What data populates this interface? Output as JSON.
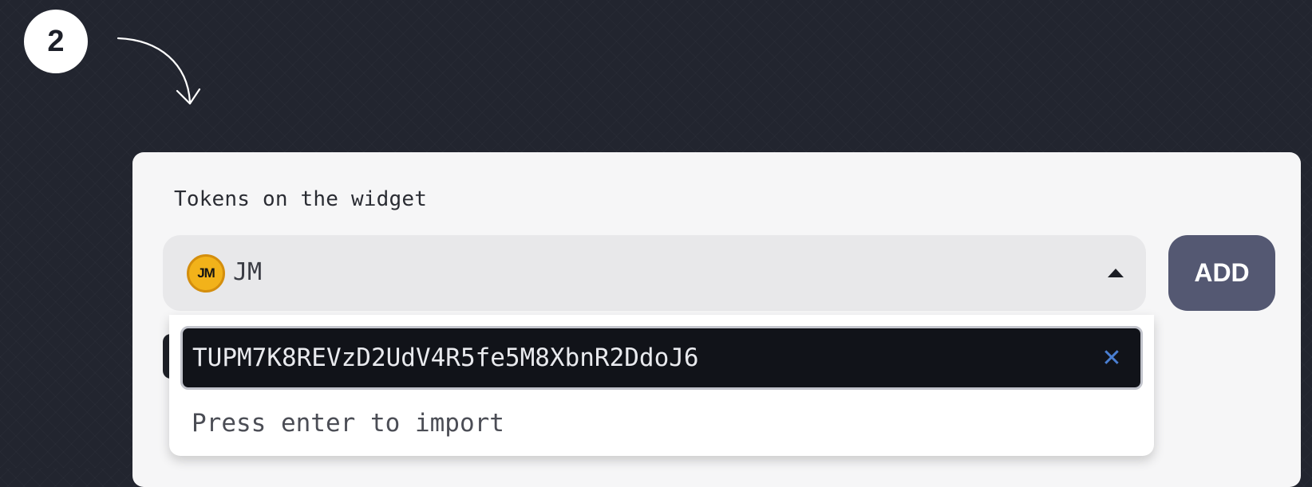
{
  "step": {
    "number": "2"
  },
  "widget": {
    "label": "Tokens on the widget",
    "selected_token": {
      "symbol": "JM",
      "icon": "jm-token-icon",
      "icon_text": "JM"
    },
    "caret_icon": "caret-up-icon",
    "add_label": "ADD",
    "dropdown": {
      "input_value": "TUPM7K8REVzD2UdV4R5fe5M8XbnR2DdoJ6",
      "clear_icon": "close-icon",
      "hint": "Press enter to import"
    }
  },
  "colors": {
    "background": "#22252f",
    "panel": "#f6f6f7",
    "add_button": "#545872",
    "clear_icon": "#4a7fd2",
    "token_logo": "#f2b21a"
  }
}
